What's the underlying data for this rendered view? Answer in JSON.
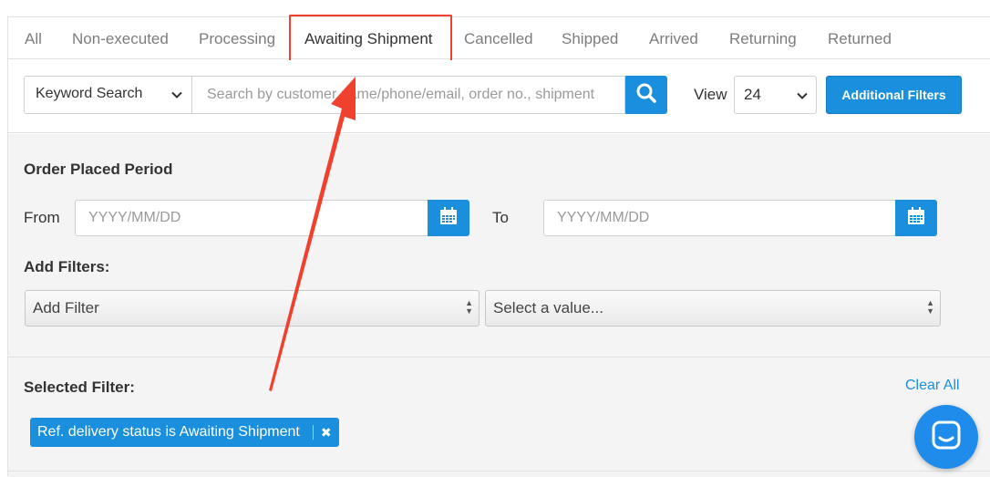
{
  "tabs": [
    {
      "label": "All"
    },
    {
      "label": "Non-executed"
    },
    {
      "label": "Processing"
    },
    {
      "label": "Awaiting Shipment"
    },
    {
      "label": "Cancelled"
    },
    {
      "label": "Shipped"
    },
    {
      "label": "Arrived"
    },
    {
      "label": "Returning"
    },
    {
      "label": "Returned"
    }
  ],
  "active_tab": "Awaiting Shipment",
  "search": {
    "type_label": "Keyword Search",
    "placeholder": "Search by customer name/phone/email, order no., shipment"
  },
  "view": {
    "label": "View",
    "value": "24"
  },
  "additional_filters_label": "Additional Filters",
  "order_period": {
    "heading": "Order Placed Period",
    "from_label": "From",
    "to_label": "To",
    "from_placeholder": "YYYY/MM/DD",
    "to_placeholder": "YYYY/MM/DD"
  },
  "add_filters": {
    "heading": "Add Filters:",
    "filter_value": "Add Filter",
    "value_placeholder": "Select a value..."
  },
  "selected_filter": {
    "heading": "Selected Filter:",
    "clear_label": "Clear All",
    "chips": [
      {
        "label": "Ref. delivery status is Awaiting Shipment"
      }
    ]
  },
  "colors": {
    "accent": "#1a8fdd",
    "annotation": "#f0412e",
    "chat": "#1f8ceb"
  },
  "icons": [
    "search-icon",
    "calendar-icon",
    "chevron-down-icon",
    "close-icon",
    "chat-icon"
  ]
}
